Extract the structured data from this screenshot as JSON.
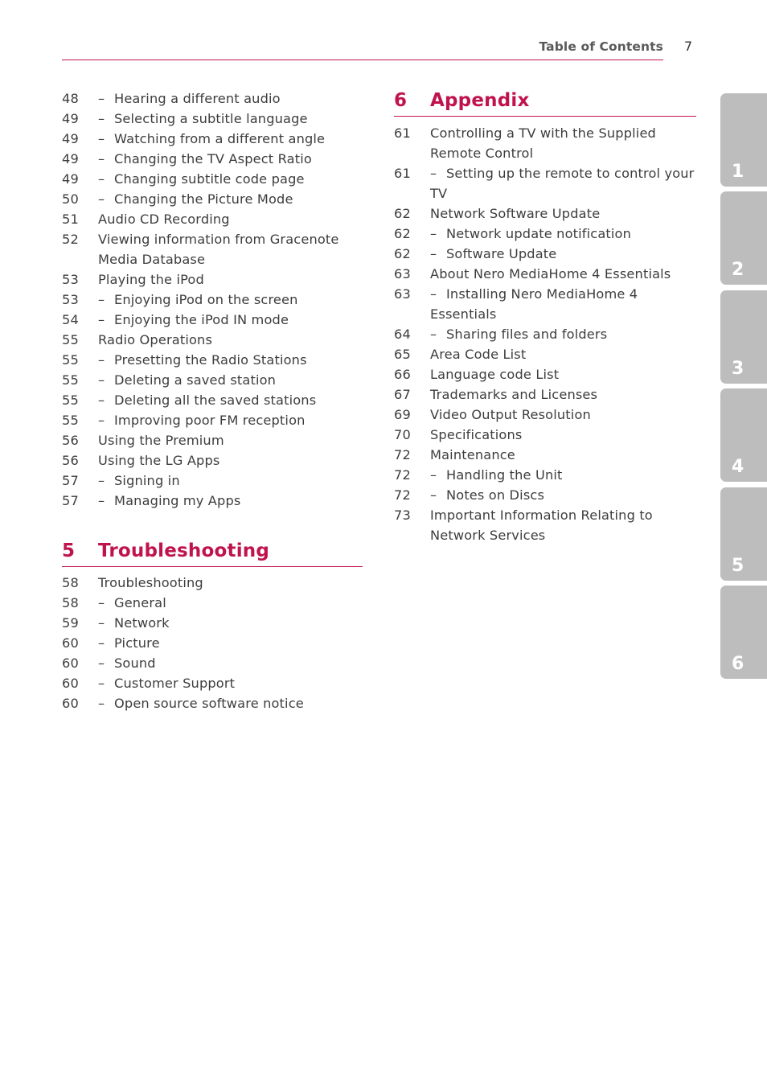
{
  "header": {
    "title": "Table of Contents",
    "page_number": "7"
  },
  "left_column": {
    "continued_items": [
      {
        "page": "48",
        "sub": true,
        "text": "Hearing a different audio"
      },
      {
        "page": "49",
        "sub": true,
        "text": "Selecting a subtitle language"
      },
      {
        "page": "49",
        "sub": true,
        "text": "Watching from a different angle"
      },
      {
        "page": "49",
        "sub": true,
        "text": "Changing the TV Aspect Ratio"
      },
      {
        "page": "49",
        "sub": true,
        "text": "Changing subtitle code page"
      },
      {
        "page": "50",
        "sub": true,
        "text": "Changing the Picture Mode"
      },
      {
        "page": "51",
        "sub": false,
        "text": "Audio CD Recording"
      },
      {
        "page": "52",
        "sub": false,
        "text": "Viewing information from Gracenote Media Database"
      },
      {
        "page": "53",
        "sub": false,
        "text": "Playing the iPod"
      },
      {
        "page": "53",
        "sub": true,
        "text": "Enjoying iPod on the screen"
      },
      {
        "page": "54",
        "sub": true,
        "text": "Enjoying the iPod IN mode"
      },
      {
        "page": "55",
        "sub": false,
        "text": "Radio Operations"
      },
      {
        "page": "55",
        "sub": true,
        "text": "Presetting the Radio Stations"
      },
      {
        "page": "55",
        "sub": true,
        "text": "Deleting a saved station"
      },
      {
        "page": "55",
        "sub": true,
        "text": "Deleting all the saved stations"
      },
      {
        "page": "55",
        "sub": true,
        "text": "Improving poor FM reception"
      },
      {
        "page": "56",
        "sub": false,
        "text": "Using the Premium"
      },
      {
        "page": "56",
        "sub": false,
        "text": "Using the LG Apps"
      },
      {
        "page": "57",
        "sub": true,
        "text": "Signing in"
      },
      {
        "page": "57",
        "sub": true,
        "text": "Managing my Apps"
      }
    ],
    "section": {
      "number": "5",
      "title": "Troubleshooting",
      "items": [
        {
          "page": "58",
          "sub": false,
          "text": "Troubleshooting"
        },
        {
          "page": "58",
          "sub": true,
          "text": "General"
        },
        {
          "page": "59",
          "sub": true,
          "text": "Network"
        },
        {
          "page": "60",
          "sub": true,
          "text": "Picture"
        },
        {
          "page": "60",
          "sub": true,
          "text": "Sound"
        },
        {
          "page": "60",
          "sub": true,
          "text": "Customer Support"
        },
        {
          "page": "60",
          "sub": true,
          "text": "Open source software notice"
        }
      ]
    }
  },
  "right_column": {
    "section": {
      "number": "6",
      "title": "Appendix",
      "items": [
        {
          "page": "61",
          "sub": false,
          "text": "Controlling a TV with the Supplied Remote Control"
        },
        {
          "page": "61",
          "sub": true,
          "text": "Setting up the remote to control your TV"
        },
        {
          "page": "62",
          "sub": false,
          "text": "Network Software Update"
        },
        {
          "page": "62",
          "sub": true,
          "text": "Network update notification"
        },
        {
          "page": "62",
          "sub": true,
          "text": "Software Update"
        },
        {
          "page": "63",
          "sub": false,
          "text": "About Nero MediaHome 4 Essentials"
        },
        {
          "page": "63",
          "sub": true,
          "text": "Installing Nero MediaHome 4 Essentials"
        },
        {
          "page": "64",
          "sub": true,
          "text": "Sharing files and folders"
        },
        {
          "page": "65",
          "sub": false,
          "text": "Area Code List"
        },
        {
          "page": "66",
          "sub": false,
          "text": "Language code List"
        },
        {
          "page": "67",
          "sub": false,
          "text": "Trademarks and Licenses"
        },
        {
          "page": "69",
          "sub": false,
          "text": "Video Output Resolution"
        },
        {
          "page": "70",
          "sub": false,
          "text": "Specifications"
        },
        {
          "page": "72",
          "sub": false,
          "text": "Maintenance"
        },
        {
          "page": "72",
          "sub": true,
          "text": "Handling the Unit"
        },
        {
          "page": "72",
          "sub": true,
          "text": "Notes on Discs"
        },
        {
          "page": "73",
          "sub": false,
          "text": "Important Information Relating to Network Services"
        }
      ]
    }
  },
  "side_tabs": [
    "1",
    "2",
    "3",
    "4",
    "5",
    "6"
  ],
  "dash": "–",
  "colors": {
    "accent": "#c0134e",
    "tab": "#bdbdbd",
    "text": "#3d3d3d"
  }
}
